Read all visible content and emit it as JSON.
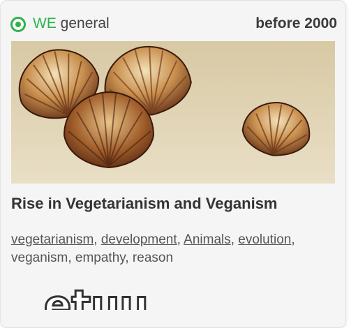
{
  "card": {
    "category_prefix": "WE",
    "category_suffix": " general",
    "date_label": "before 2000",
    "image_alt": "shells",
    "title": "Rise in Vegetarianism and Veganism",
    "tags": [
      {
        "label": "vegetarianism",
        "link": true
      },
      {
        "label": "development",
        "link": true
      },
      {
        "label": "Animals",
        "link": true
      },
      {
        "label": "evolution",
        "link": true
      },
      {
        "label": "veganism",
        "link": false
      },
      {
        "label": "empathy",
        "link": false
      },
      {
        "label": "reason",
        "link": false
      }
    ],
    "logo_text": "etuu"
  },
  "colors": {
    "accent_green": "#2fb24c",
    "text_dark": "#333333",
    "text_muted": "#555555",
    "card_bg": "#f5f5f5",
    "image_bg": "#dccfae"
  },
  "icons": {
    "radio": "radio-selected-icon"
  }
}
